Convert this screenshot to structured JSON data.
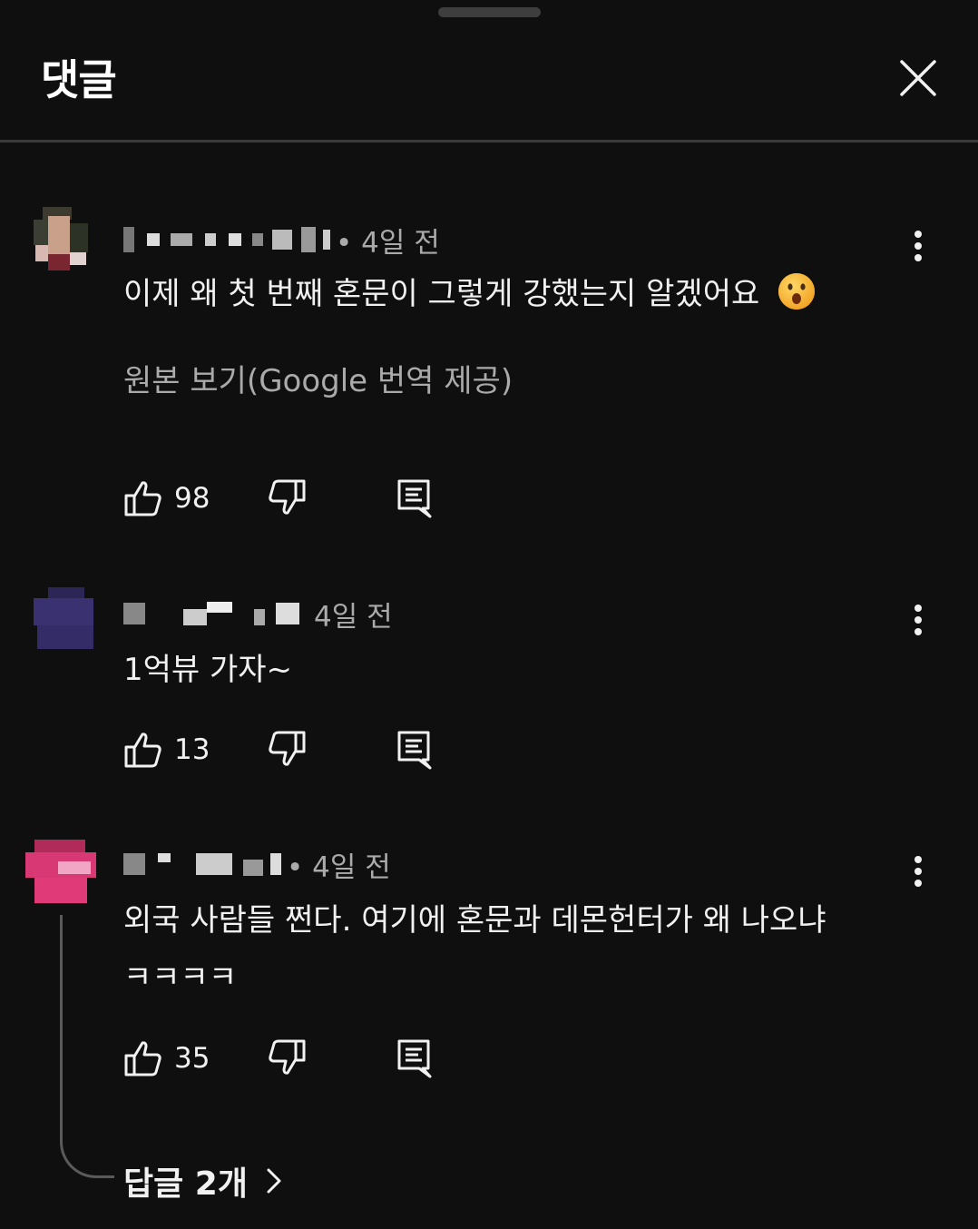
{
  "panel": {
    "title": "댓글"
  },
  "comments": [
    {
      "time": "• 4일 전",
      "text": "이제 왜 첫 번째 혼문이 그렇게 강했는지 알겠어요",
      "emoji": "hushed-face",
      "translate_link": "원본 보기(Google 번역 제공)",
      "likes": "98"
    },
    {
      "time": "4일 전",
      "text": "1억뷰 가자~",
      "likes": "13"
    },
    {
      "time": "• 4일 전",
      "text_line1": "외국 사람들 쩐다.  여기에 혼문과 데몬헌터가 왜 나오냐",
      "text_line2": "ㅋㅋㅋㅋ",
      "likes": "35",
      "replies_label": "답글 2개"
    }
  ],
  "icons": [
    "close-icon",
    "more-vert-icon",
    "thumb-up-icon",
    "thumb-down-icon",
    "reply-icon",
    "chevron-right-icon"
  ],
  "colors": {
    "background": "#0f0f0f",
    "text": "#f1f1f1",
    "secondary_text": "#aaaaaa",
    "divider": "#3a3a3a"
  }
}
